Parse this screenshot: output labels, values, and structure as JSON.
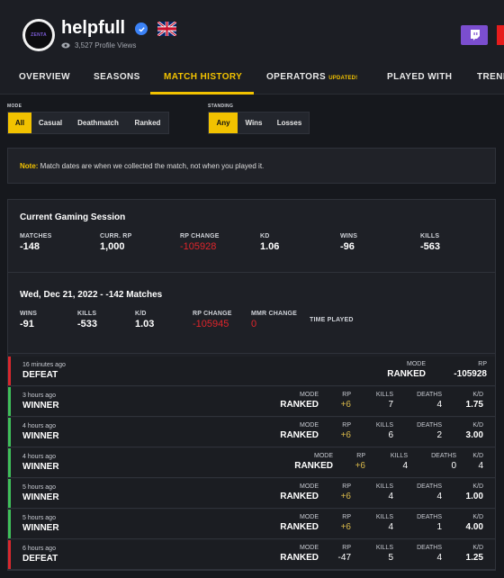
{
  "profile": {
    "avatar_text": "ZENTA",
    "username": "helpfull",
    "views": "3,527 Profile Views",
    "verified_icon": "verified-badge-icon",
    "flag_icon": "uk-flag-icon"
  },
  "tabs": [
    {
      "label": "OVERVIEW"
    },
    {
      "label": "SEASONS"
    },
    {
      "label": "MATCH HISTORY",
      "active": true
    },
    {
      "label": "OPERATORS",
      "badge": "UPDATED!"
    },
    {
      "label": "PLAYED WITH"
    },
    {
      "label": "TRENDS"
    }
  ],
  "filters": {
    "mode": {
      "label": "MODE",
      "options": [
        "All",
        "Casual",
        "Deathmatch",
        "Ranked"
      ],
      "selected": "All"
    },
    "standing": {
      "label": "STANDING",
      "options": [
        "Any",
        "Wins",
        "Losses"
      ],
      "selected": "Any"
    }
  },
  "note": {
    "prefix": "Note:",
    "text": " Match dates are when we collected the match, not when you played it."
  },
  "session": {
    "title": "Current Gaming Session",
    "stats": [
      {
        "label": "MATCHES",
        "value": "-148"
      },
      {
        "label": "CURR. RP",
        "value": "1,000"
      },
      {
        "label": "RP CHANGE",
        "value": "-105928",
        "negative": true
      },
      {
        "label": "KD",
        "value": "1.06"
      },
      {
        "label": "WINS",
        "value": "-96"
      },
      {
        "label": "KILLS",
        "value": "-563"
      }
    ]
  },
  "day": {
    "title": "Wed, Dec 21, 2022 - -142 Matches",
    "stats": [
      {
        "label": "WINS",
        "value": "-91"
      },
      {
        "label": "KILLS",
        "value": "-533"
      },
      {
        "label": "K/D",
        "value": "1.03"
      },
      {
        "label": "RP CHANGE",
        "value": "-105945",
        "negative": true
      },
      {
        "label": "MMR CHANGE",
        "value": "0",
        "negative": true
      },
      {
        "label": "TIME PLAYED",
        "value": ""
      }
    ]
  },
  "match_labels": {
    "mode": "MODE",
    "rp": "RP",
    "kills": "KILLS",
    "deaths": "DEATHS",
    "kd": "K/D"
  },
  "colors": {
    "accent": "#f2c200",
    "win": "#3fbf5a",
    "loss": "#d9282e",
    "negative": "#e0252b"
  },
  "matches": [
    {
      "time": "16 minutes ago",
      "result": "DEFEAT",
      "outcome": "loss",
      "mode": "RANKED",
      "rp": "-105928"
    },
    {
      "time": "3 hours ago",
      "result": "WINNER",
      "outcome": "win",
      "mode": "RANKED",
      "rp": "+6",
      "kills": "7",
      "deaths": "4",
      "kd": "1.75"
    },
    {
      "time": "4 hours ago",
      "result": "WINNER",
      "outcome": "win",
      "mode": "RANKED",
      "rp": "+6",
      "kills": "6",
      "deaths": "2",
      "kd": "3.00"
    },
    {
      "time": "4 hours ago",
      "result": "WINNER",
      "outcome": "win",
      "mode": "RANKED",
      "rp": "+6",
      "kills": "4",
      "deaths": "0",
      "kd": "4"
    },
    {
      "time": "5 hours ago",
      "result": "WINNER",
      "outcome": "win",
      "mode": "RANKED",
      "rp": "+6",
      "kills": "4",
      "deaths": "4",
      "kd": "1.00"
    },
    {
      "time": "5 hours ago",
      "result": "WINNER",
      "outcome": "win",
      "mode": "RANKED",
      "rp": "+6",
      "kills": "4",
      "deaths": "1",
      "kd": "4.00"
    },
    {
      "time": "6 hours ago",
      "result": "DEFEAT",
      "outcome": "loss",
      "mode": "RANKED",
      "rp": "-47",
      "kills": "5",
      "deaths": "4",
      "kd": "1.25"
    }
  ]
}
